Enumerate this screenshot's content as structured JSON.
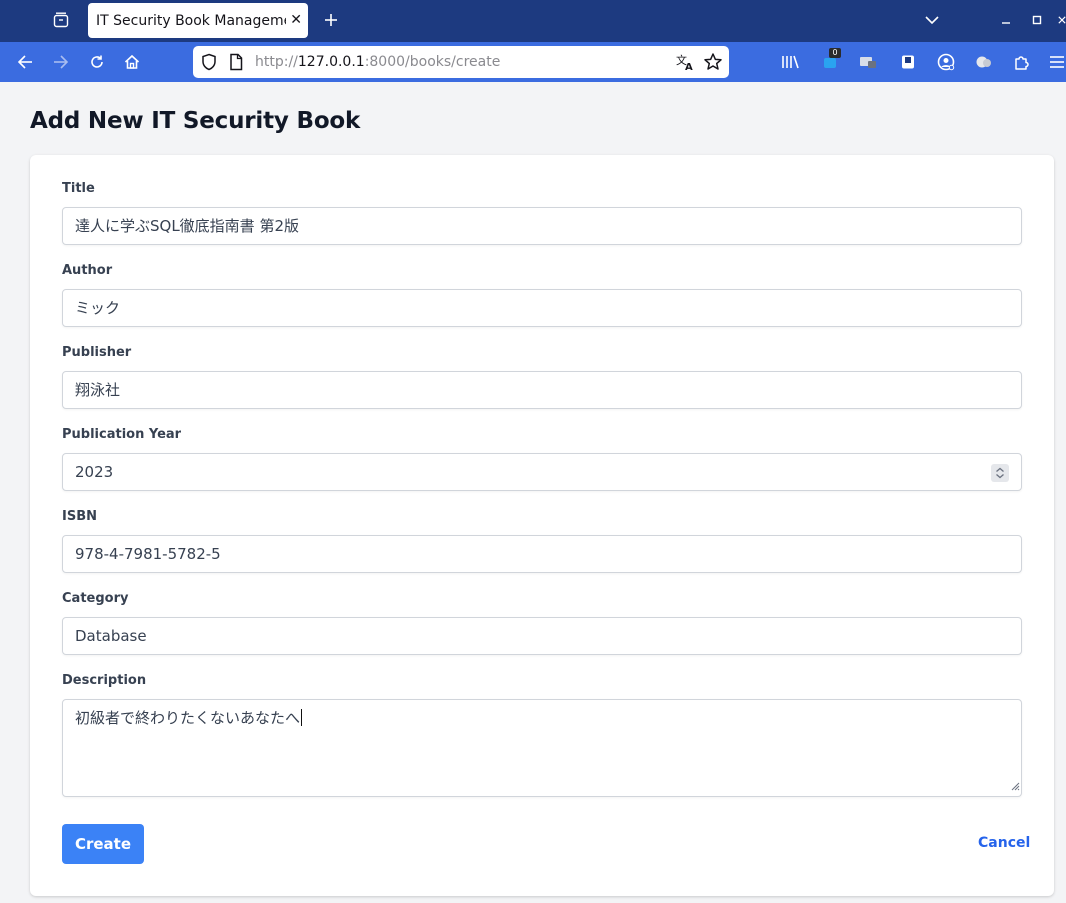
{
  "browser": {
    "tab_title": "IT Security Book Management",
    "url_protocol": "http://",
    "url_host": "127.0.0.1",
    "url_path": ":8000/books/create",
    "extension_badge": "0",
    "colors": {
      "tabbar": "#1d3a80",
      "toolbar": "#3b6ce0"
    }
  },
  "page": {
    "title": "Add New IT Security Book"
  },
  "form": {
    "title": {
      "label": "Title",
      "value": "達人に学ぶSQL徹底指南書 第2版"
    },
    "author": {
      "label": "Author",
      "value": "ミック"
    },
    "publisher": {
      "label": "Publisher",
      "value": "翔泳社"
    },
    "year": {
      "label": "Publication Year",
      "value": "2023"
    },
    "isbn": {
      "label": "ISBN",
      "value": "978-4-7981-5782-5"
    },
    "category": {
      "label": "Category",
      "value": "Database"
    },
    "description": {
      "label": "Description",
      "value": "初級者で終わりたくないあなたへ"
    },
    "create_label": "Create",
    "cancel_label": "Cancel",
    "colors": {
      "primary": "#3b82f6",
      "link": "#2563eb"
    }
  }
}
